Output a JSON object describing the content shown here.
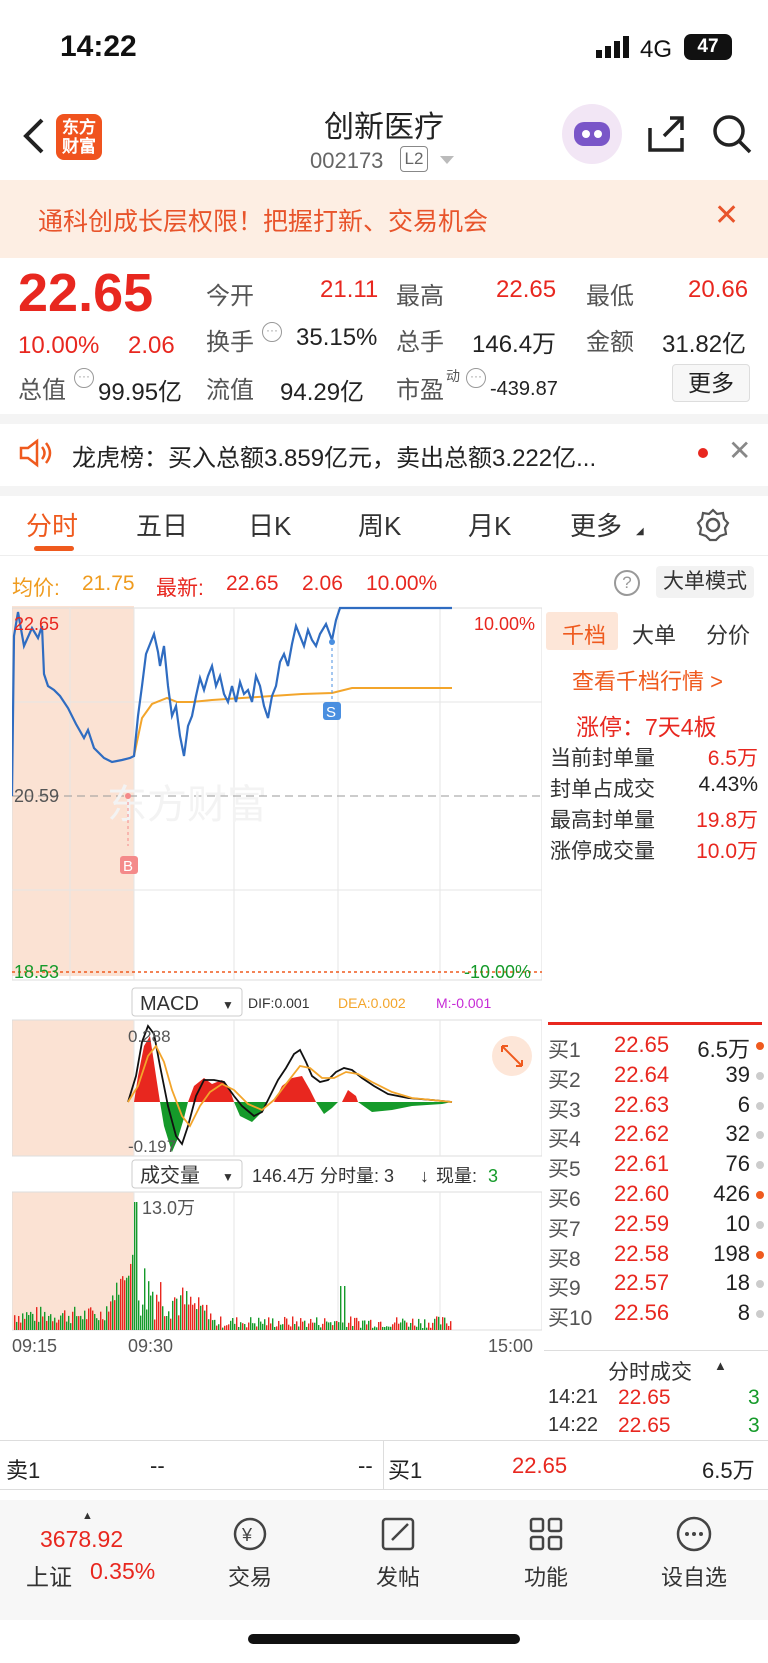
{
  "status": {
    "time": "14:22",
    "network": "4G",
    "battery": "47"
  },
  "header": {
    "title": "创新医疗",
    "code": "002173",
    "level": "L2",
    "logo": "东方\n财富"
  },
  "banner": {
    "text": "通科创成长层权限！把握打新、交易机会",
    "close": "✕"
  },
  "quote": {
    "price": "22.65",
    "change_pct": "10.00%",
    "change": "2.06",
    "open_label": "今开",
    "open": "21.11",
    "high_label": "最高",
    "high": "22.65",
    "low_label": "最低",
    "low": "20.66",
    "turnover_label": "换手",
    "turnover": "35.15%",
    "volume_label": "总手",
    "volume": "146.4万",
    "amount_label": "金额",
    "amount": "31.82亿",
    "mktcap_label": "总值",
    "mktcap": "99.95亿",
    "float_label": "流值",
    "float": "94.29亿",
    "pe_label": "市盈",
    "pe_sup": "动",
    "pe": "-439.87",
    "more": "更多"
  },
  "dragon": {
    "text": "龙虎榜：买入总额3.859亿元，卖出总额3.222亿..."
  },
  "tabs": [
    "分时",
    "五日",
    "日K",
    "周K",
    "月K",
    "更多"
  ],
  "info": {
    "avg_label": "均价:",
    "avg": "21.75",
    "last_label": "最新:",
    "last": "22.65",
    "chg": "2.06",
    "pct": "10.00%",
    "mode": "大单模式"
  },
  "chart": {
    "y_top": "22.65",
    "y_mid": "20.59",
    "y_bot": "18.53",
    "pct_top": "10.00%",
    "pct_bot": "-10.00%",
    "buy_marker": "B",
    "sell_marker": "S",
    "watermark": "东方财富",
    "macd_label": "MACD",
    "dif": "DIF:0.001",
    "dea": "DEA:0.002",
    "m": "M:-0.001",
    "macd_top": "0.288",
    "macd_bot": "-0.197",
    "vol_label": "成交量",
    "vol_info": "146.4万 分时量: 3",
    "vol_now_label": "现量:",
    "vol_now": "3",
    "vol_max": "13.0万",
    "t_start": "09:15",
    "t_open": "09:30",
    "t_end": "15:00"
  },
  "side": {
    "tabs": [
      "千档",
      "大单",
      "分价"
    ],
    "link": "查看千档行情 >",
    "limit_up": "涨停：7天4板",
    "seal": [
      {
        "label": "当前封单量",
        "value": "6.5万"
      },
      {
        "label": "封单占成交",
        "value": "4.43%"
      },
      {
        "label": "最高封单量",
        "value": "19.8万"
      },
      {
        "label": "涨停成交量",
        "value": "10.0万"
      }
    ],
    "bids": [
      {
        "label": "买1",
        "price": "22.65",
        "vol": "6.5万",
        "dot": "#ef5a1e"
      },
      {
        "label": "买2",
        "price": "22.64",
        "vol": "39",
        "dot": "#cccccc"
      },
      {
        "label": "买3",
        "price": "22.63",
        "vol": "6",
        "dot": "#cccccc"
      },
      {
        "label": "买4",
        "price": "22.62",
        "vol": "32",
        "dot": "#cccccc"
      },
      {
        "label": "买5",
        "price": "22.61",
        "vol": "76",
        "dot": "#cccccc"
      },
      {
        "label": "买6",
        "price": "22.60",
        "vol": "426",
        "dot": "#ef5a1e"
      },
      {
        "label": "买7",
        "price": "22.59",
        "vol": "10",
        "dot": "#cccccc"
      },
      {
        "label": "买8",
        "price": "22.58",
        "vol": "198",
        "dot": "#ef5a1e"
      },
      {
        "label": "买9",
        "price": "22.57",
        "vol": "18",
        "dot": "#cccccc"
      },
      {
        "label": "买10",
        "price": "22.56",
        "vol": "8",
        "dot": "#cccccc"
      }
    ],
    "ticks_title": "分时成交",
    "ticks": [
      {
        "time": "14:21",
        "price": "22.65",
        "vol": "3"
      },
      {
        "time": "14:22",
        "price": "22.65",
        "vol": "3"
      }
    ]
  },
  "bidask": {
    "sell_label": "卖1",
    "sell_price": "--",
    "sell_vol": "--",
    "buy_label": "买1",
    "buy_price": "22.65",
    "buy_vol": "6.5万"
  },
  "nav": {
    "index_value": "3678.92",
    "index_name": "上证",
    "index_pct": "0.35%",
    "items": [
      "交易",
      "发帖",
      "功能",
      "设自选"
    ]
  }
}
